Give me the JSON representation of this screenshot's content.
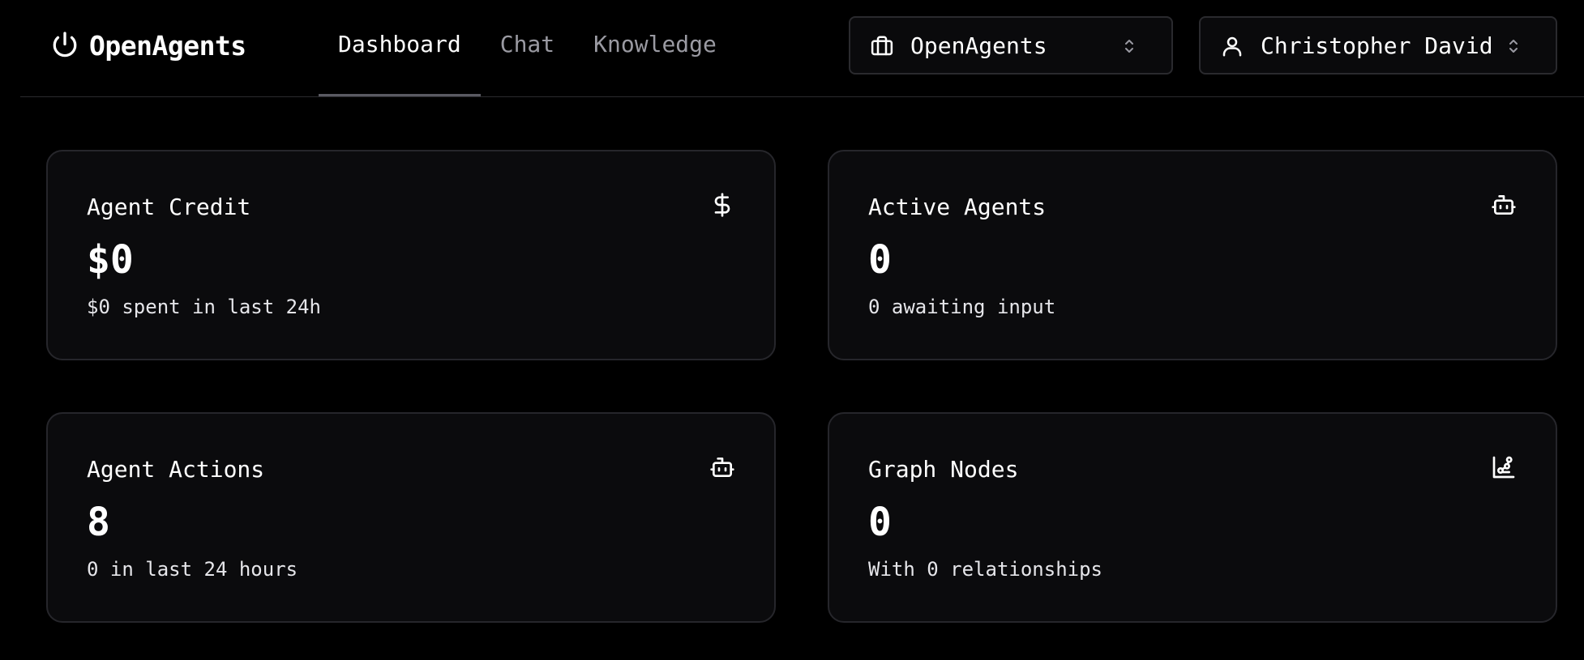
{
  "brand": {
    "name": "OpenAgents",
    "icon": "power-icon"
  },
  "nav": {
    "tabs": [
      {
        "label": "Dashboard",
        "active": true
      },
      {
        "label": "Chat",
        "active": false
      },
      {
        "label": "Knowledge",
        "active": false
      }
    ]
  },
  "org_selector": {
    "value": "OpenAgents",
    "icon": "briefcase-icon"
  },
  "user_selector": {
    "value": "Christopher David",
    "icon": "user-icon"
  },
  "cards": [
    {
      "title": "Agent Credit",
      "value": "$0",
      "subtitle": "$0 spent in last 24h",
      "icon": "dollar-icon"
    },
    {
      "title": "Active Agents",
      "value": "0",
      "subtitle": "0 awaiting input",
      "icon": "bot-icon"
    },
    {
      "title": "Agent Actions",
      "value": "8",
      "subtitle": "0 in last 24 hours",
      "icon": "bot-icon"
    },
    {
      "title": "Graph Nodes",
      "value": "0",
      "subtitle": "With 0 relationships",
      "icon": "graph-chart-icon"
    }
  ],
  "colors": {
    "background": "#000000",
    "card_background": "#0b0b0d",
    "border": "#26262b",
    "muted_text": "#9a9aa2",
    "active_tab_underline": "#5a5a62"
  }
}
